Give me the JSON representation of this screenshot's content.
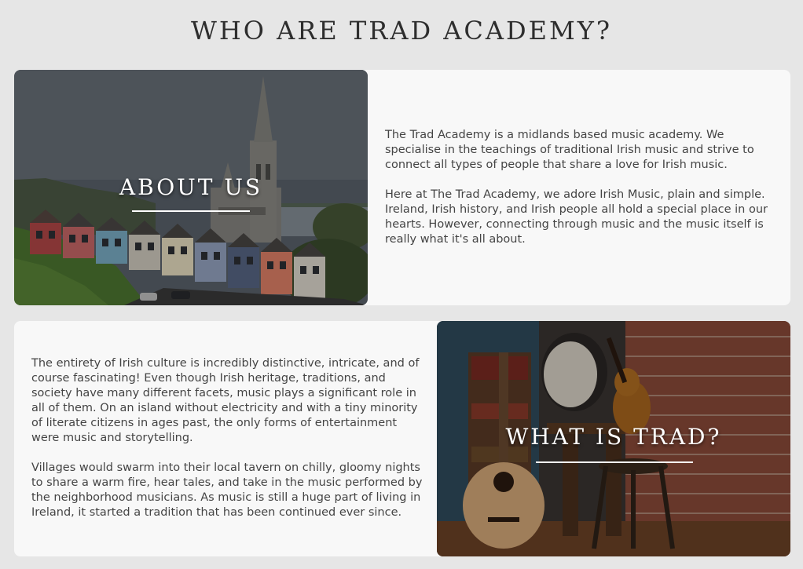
{
  "heading": "WHO ARE TRAD ACADEMY?",
  "about": {
    "label": "ABOUT US",
    "paragraphs": [
      "The Trad Academy is a midlands based music academy. We specialise in the teachings of traditional Irish music and strive to connect all types of people that share a love for Irish music.",
      "Here at The Trad Academy, we adore Irish Music, plain and simple. Ireland, Irish history, and Irish people all hold a special place in our hearts. However, connecting through music and the music itself is really what it's all about."
    ]
  },
  "trad": {
    "label": "WHAT IS TRAD?",
    "paragraphs": [
      "The entirety of Irish culture is incredibly distinctive, intricate, and of course fascinating! Even though Irish heritage, traditions, and society have many different facets, music plays a significant role in all of them. On an island without electricity and with a tiny minority of literate citizens in ages past, the only forms of entertainment were music and storytelling.",
      "Villages would swarm into their local tavern on chilly, gloomy nights to share a warm fire, hear tales, and take in the music performed by the neighborhood musicians. As music is still a huge part of living in Ireland, it started a tradition that has been continued ever since."
    ]
  }
}
